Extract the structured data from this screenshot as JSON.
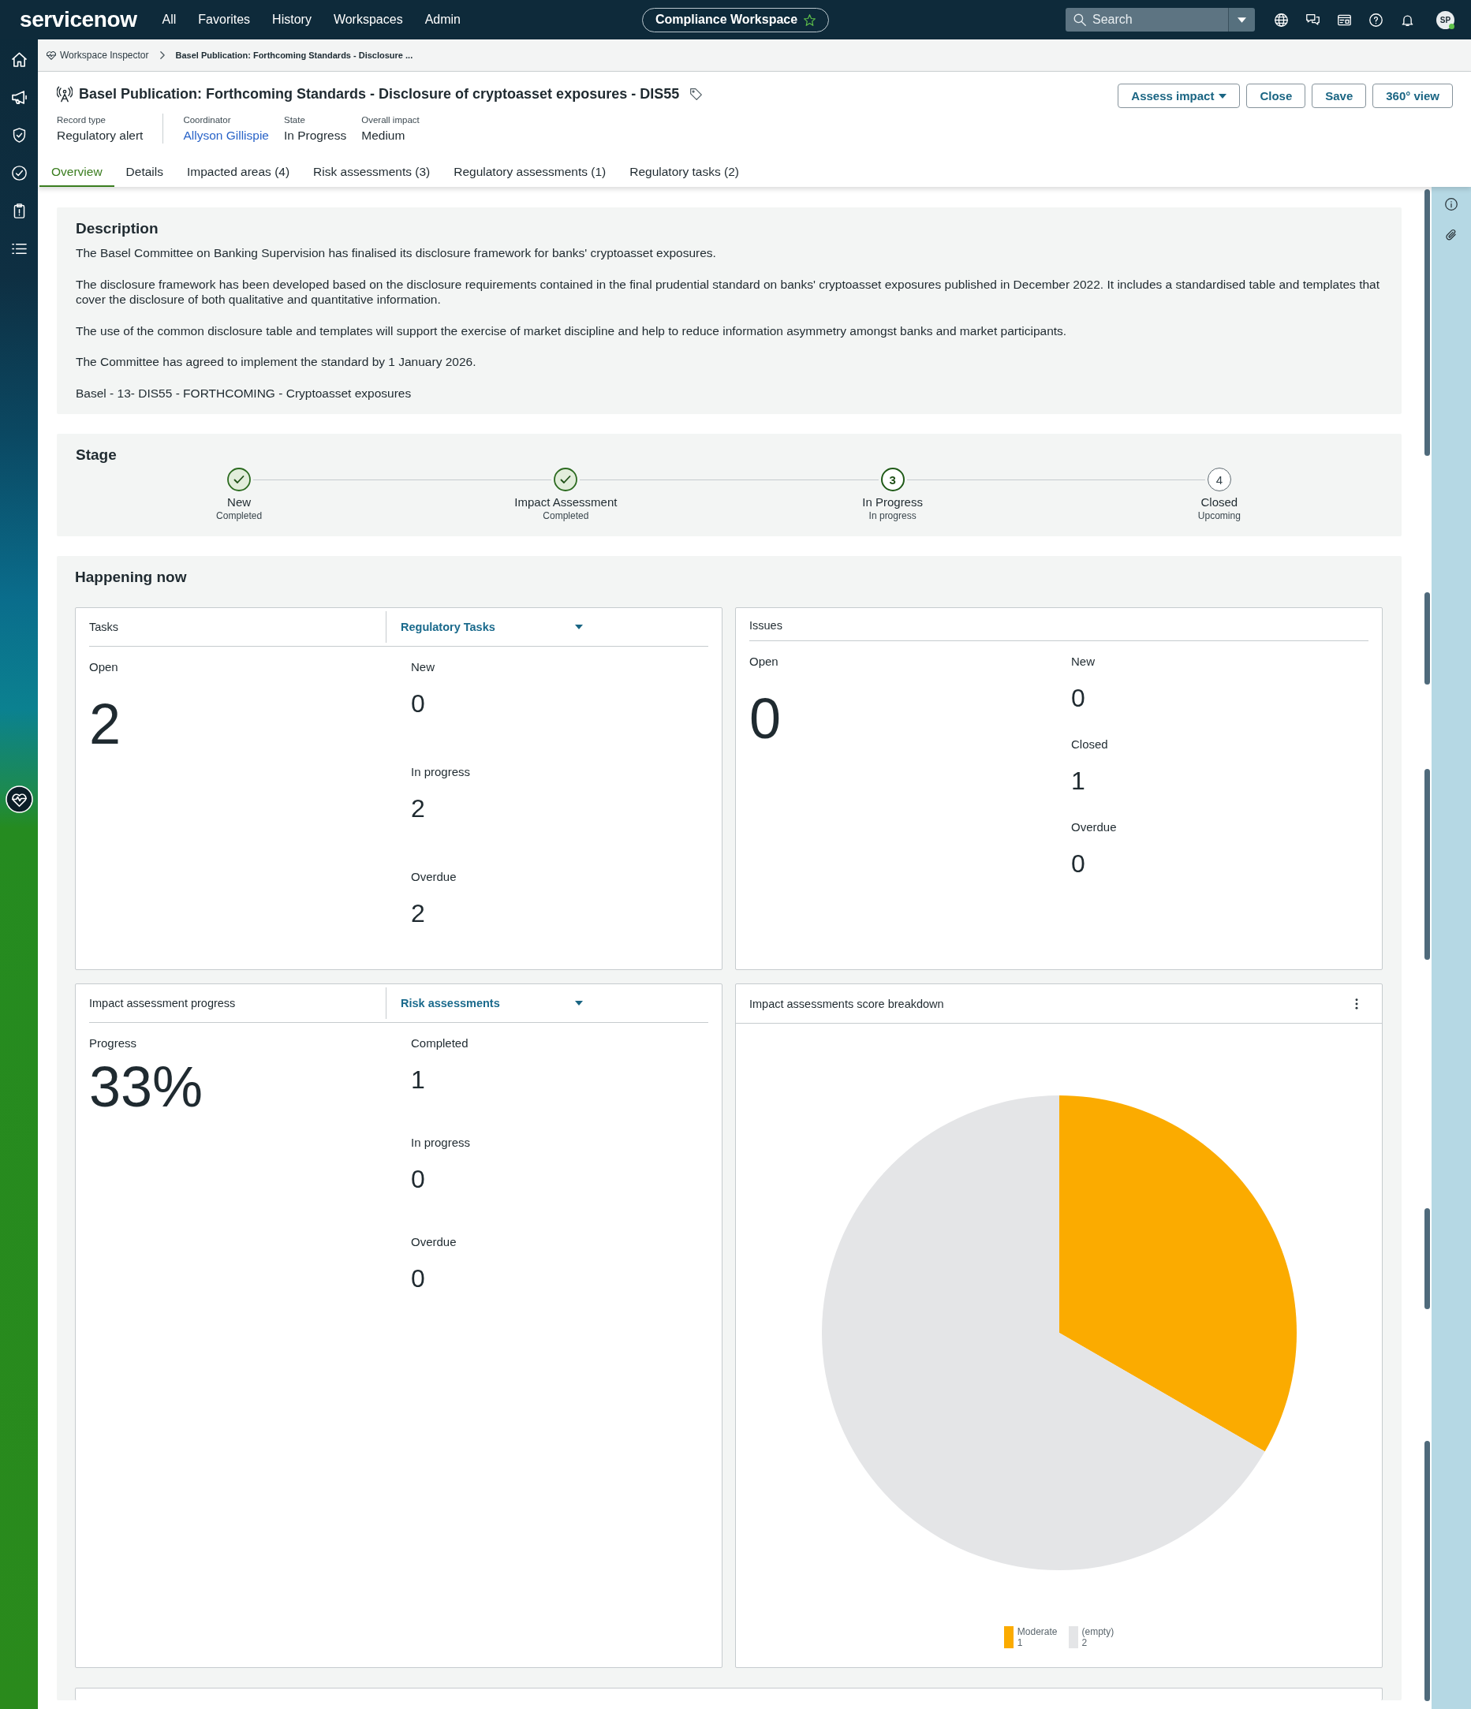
{
  "top_nav": {
    "logo": "servicenow",
    "menu": [
      "All",
      "Favorites",
      "History",
      "Workspaces",
      "Admin"
    ],
    "workspace": "Compliance Workspace",
    "favorite": false,
    "search": {
      "placeholder": "Search"
    },
    "avatar": {
      "initials": "SP",
      "online": true
    }
  },
  "breadcrumbs": [
    "Workspace Inspector",
    "Basel Publication: Forthcoming Standards - Disclosure ..."
  ],
  "record": {
    "title": "Basel Publication: Forthcoming Standards - Disclosure of cryptoasset exposures - DIS55",
    "fields": [
      {
        "label": "Record type",
        "value": "Regulatory alert",
        "kind": "text"
      },
      {
        "label": "Coordinator",
        "value": "Allyson Gillispie",
        "kind": "link"
      },
      {
        "label": "State",
        "value": "In Progress",
        "kind": "text"
      },
      {
        "label": "Overall impact",
        "value": "Medium",
        "kind": "text"
      }
    ],
    "buttons": [
      {
        "label": "Assess impact",
        "dropdown": true
      },
      {
        "label": "Close",
        "dropdown": false
      },
      {
        "label": "Save",
        "dropdown": false
      },
      {
        "label": "360° view",
        "dropdown": false
      }
    ]
  },
  "tabs": [
    {
      "label": "Overview",
      "selected": true
    },
    {
      "label": "Details",
      "selected": false
    },
    {
      "label": "Impacted areas (4)",
      "selected": false
    },
    {
      "label": "Risk assessments (3)",
      "selected": false
    },
    {
      "label": "Regulatory assessments (1)",
      "selected": false
    },
    {
      "label": "Regulatory tasks (2)",
      "selected": false
    }
  ],
  "description": {
    "title": "Description",
    "paragraphs": [
      "The Basel Committee on Banking Supervision has finalised its disclosure framework for banks' cryptoasset exposures.",
      "The disclosure framework has been developed based on the disclosure requirements contained in the final prudential standard on banks' cryptoasset exposures published in December 2022. It includes a standardised table and templates that cover the disclosure of both qualitative and quantitative information.",
      "The use of the common disclosure table and templates will support the exercise of market discipline and help to reduce information asymmetry amongst banks and market participants.",
      "The Committee has agreed to implement the standard by 1 January 2026.",
      "Basel - 13- DIS55 - FORTHCOMING - Cryptoasset exposures"
    ]
  },
  "stage": {
    "title": "Stage",
    "steps": [
      {
        "label": "New",
        "status": "Completed",
        "completed": true,
        "current": false
      },
      {
        "label": "Impact Assessment",
        "status": "Completed",
        "completed": true,
        "current": false
      },
      {
        "label": "In Progress",
        "status": "In progress",
        "completed": false,
        "current": true,
        "number": "3"
      },
      {
        "label": "Closed",
        "status": "Upcoming",
        "completed": false,
        "current": false,
        "number": "4"
      }
    ]
  },
  "happening_now": {
    "title": "Happening now",
    "panels": [
      {
        "kind": "stats",
        "title": "Tasks",
        "dropdown": "Regulatory Tasks",
        "primary": {
          "label": "Open",
          "value": "2"
        },
        "stats": [
          {
            "label": "New",
            "value": "0"
          },
          {
            "label": "In progress",
            "value": "2"
          },
          {
            "label": "Overdue",
            "value": "2"
          }
        ]
      },
      {
        "kind": "stats",
        "title": "Issues",
        "primary": {
          "label": "Open",
          "value": "0"
        },
        "stats": [
          {
            "label": "New",
            "value": "0"
          },
          {
            "label": "Closed",
            "value": "1"
          },
          {
            "label": "Overdue",
            "value": "0"
          }
        ]
      },
      {
        "kind": "stats",
        "title": "Impact assessment progress",
        "dropdown": "Risk assessments",
        "primary": {
          "label": "Progress",
          "value": "33%"
        },
        "stats": [
          {
            "label": "Completed",
            "value": "1"
          },
          {
            "label": "In progress",
            "value": "0"
          },
          {
            "label": "Overdue",
            "value": "0"
          }
        ]
      },
      {
        "kind": "chart",
        "title": "Impact assessments score breakdown",
        "chart_data": {
          "type": "pie",
          "categories": [
            "Moderate",
            "(empty)"
          ],
          "values": [
            1,
            2
          ],
          "value_labels": [
            "1",
            "2"
          ],
          "colors": [
            "#fbab00",
            "#e4e5e7"
          ],
          "legend": "bottom"
        }
      }
    ]
  }
}
